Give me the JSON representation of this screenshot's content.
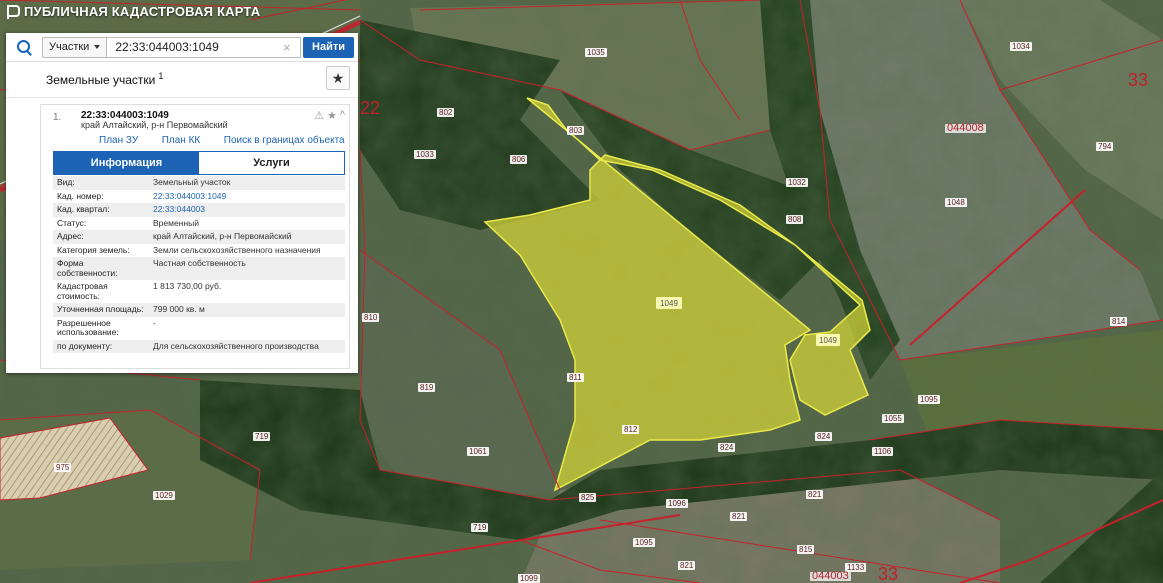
{
  "app": {
    "title": "ПУБЛИЧНАЯ КАДАСТРОВАЯ КАРТА"
  },
  "search": {
    "type_label": "Участки",
    "value": "22:33:044003:1049",
    "clear_glyph": "×",
    "button_label": "Найти"
  },
  "results": {
    "title": "Земельные участки",
    "count": "1",
    "favorite_glyph": "★",
    "item": {
      "index": "1.",
      "number": "22:33:044003:1049",
      "address": "край Алтайский, р-н Первомайский",
      "warn_glyph": "⚠",
      "star_glyph": "★",
      "collapse_glyph": "^",
      "links": [
        "План ЗУ →",
        "План КК →",
        "Поиск в границах объекта →"
      ],
      "tabs": [
        "Информация",
        "Услуги"
      ],
      "rows": [
        {
          "k": "Вид:",
          "v": "Земельный участок"
        },
        {
          "k": "Кад. номер:",
          "v": "22:33:044003:1049"
        },
        {
          "k": "Кад. квартал:",
          "v": "22:33:044003"
        },
        {
          "k": "Статус:",
          "v": "Временный"
        },
        {
          "k": "Адрес:",
          "v": "край Алтайский, р-н Первомайский"
        },
        {
          "k": "Категория земель:",
          "v": "Земли сельскохозяйственного назначения"
        },
        {
          "k": "Форма собственности:",
          "v": "Частная собственность"
        },
        {
          "k": "Кадастровая стоимость:",
          "v": "1 813 730,00 руб."
        },
        {
          "k": "Уточненная площадь:",
          "v": "799 000 кв. м"
        },
        {
          "k": "Разрешенное использование:",
          "v": "-"
        },
        {
          "k": "по документу:",
          "v": "Для сельскохозяйственного производства"
        }
      ]
    }
  },
  "map": {
    "colors": {
      "parcel_border": "#c8202c",
      "selected_fill": "#d4d43a",
      "field": "#6e7550",
      "forest": "#1f3a1a"
    },
    "labels": {
      "l1035": "1035",
      "l1034": "1034",
      "l33a": "33",
      "l22": "22",
      "l044008": "044008",
      "l802": "802",
      "l803": "803",
      "l806": "806",
      "l1033": "1033",
      "l1032": "1032",
      "l808": "808",
      "l1048": "1048",
      "l794": "794",
      "l1049a": "1049",
      "l1049b": "1049",
      "l810": "810",
      "l814": "814",
      "l819": "819",
      "l811": "811",
      "l1095a": "1095",
      "l1095b": "1095",
      "l1055": "1055",
      "l824a": "824",
      "l824b": "824",
      "l812": "812",
      "l1106": "1106",
      "l719a": "719",
      "l719b": "719",
      "l1061": "1061",
      "l975": "975",
      "l1029": "1029",
      "l825": "825",
      "l1096": "1096",
      "l821a": "821",
      "l821b": "821",
      "l1095c": "1095",
      "l815": "815",
      "l1133": "1133",
      "l044003": "044003",
      "l33b": "33",
      "l1099": "1099",
      "l821c": "821"
    }
  }
}
